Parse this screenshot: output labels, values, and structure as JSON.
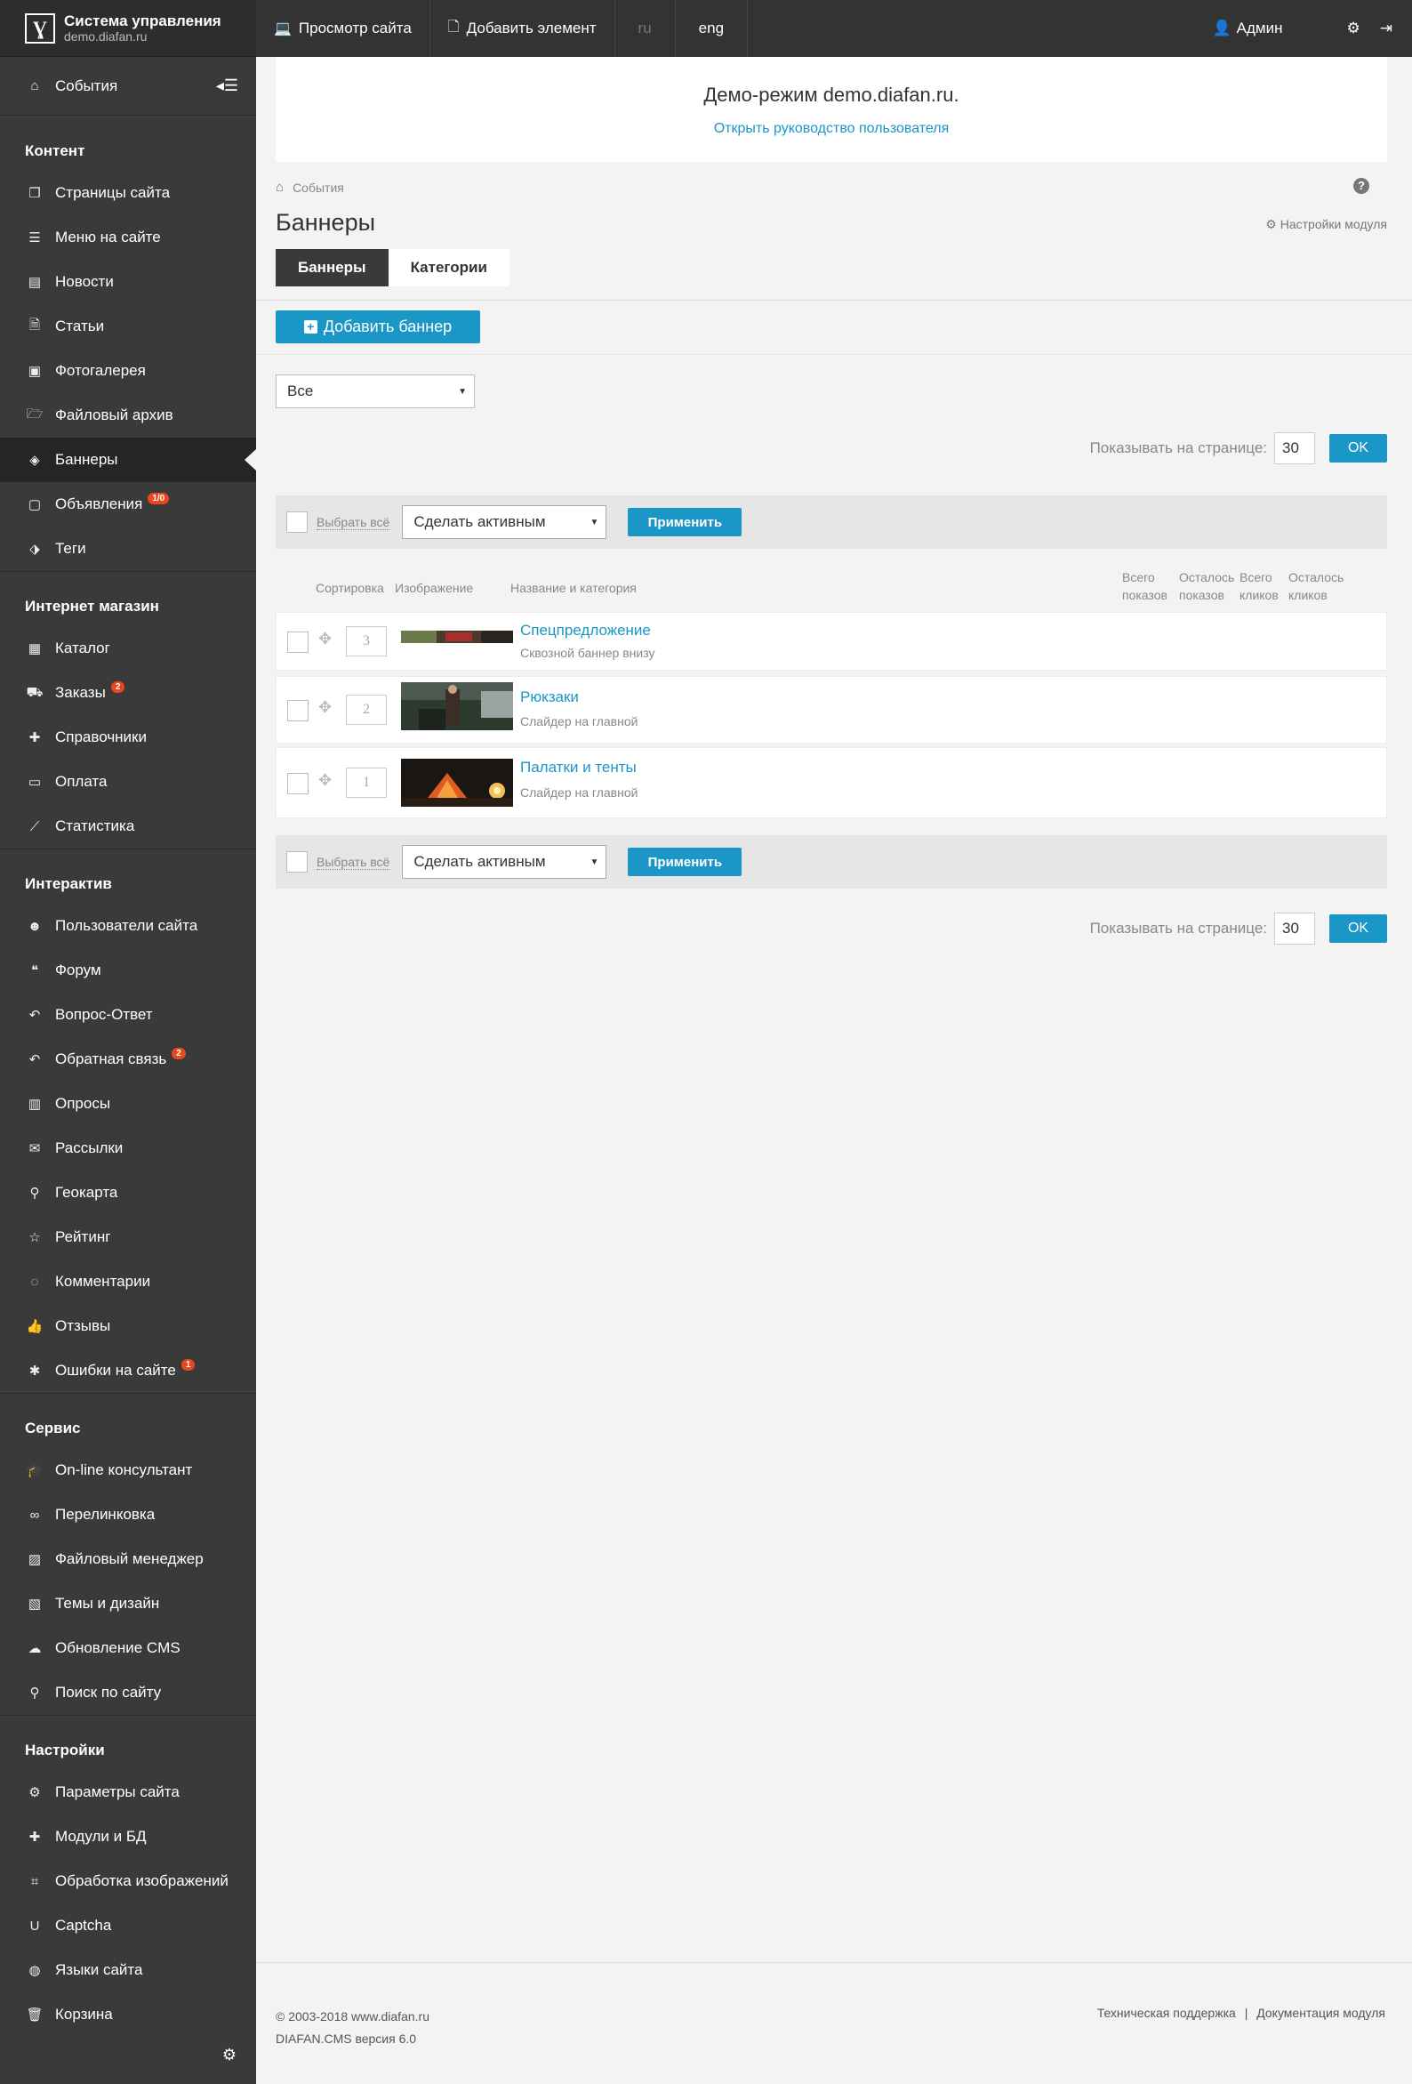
{
  "brand": {
    "title": "Система управления",
    "subtitle": "demo.diafan.ru"
  },
  "sidebar": {
    "events": "События",
    "sections": [
      {
        "title": "Контент",
        "items": [
          {
            "label": "Страницы сайта",
            "icon": "pages-icon",
            "glyph": "❐"
          },
          {
            "label": "Меню на сайте",
            "icon": "menu-icon",
            "glyph": "☰"
          },
          {
            "label": "Новости",
            "icon": "news-icon",
            "glyph": "▤"
          },
          {
            "label": "Статьи",
            "icon": "document-icon",
            "glyph": "🗎"
          },
          {
            "label": "Фотогалерея",
            "icon": "picture-icon",
            "glyph": "▣"
          },
          {
            "label": "Файловый архив",
            "icon": "folder-icon",
            "glyph": "🗁"
          },
          {
            "label": "Баннеры",
            "icon": "ticket-icon",
            "glyph": "◈",
            "active": true
          },
          {
            "label": "Объявления",
            "icon": "note-icon",
            "glyph": "▢",
            "badge": "1/0"
          },
          {
            "label": "Теги",
            "icon": "tags-icon",
            "glyph": "⬗"
          }
        ]
      },
      {
        "title": "Интернет магазин",
        "items": [
          {
            "label": "Каталог",
            "icon": "grid-icon",
            "glyph": "▦"
          },
          {
            "label": "Заказы",
            "icon": "cart-icon",
            "glyph": "⛟",
            "badge": "2"
          },
          {
            "label": "Справочники",
            "icon": "puzzle-icon",
            "glyph": "✚"
          },
          {
            "label": "Оплата",
            "icon": "credit-card-icon",
            "glyph": "▭"
          },
          {
            "label": "Статистика",
            "icon": "line-chart-icon",
            "glyph": "⟋"
          }
        ]
      },
      {
        "title": "Интерактив",
        "items": [
          {
            "label": "Пользователи сайта",
            "icon": "users-icon",
            "glyph": "☻"
          },
          {
            "label": "Форум",
            "icon": "comments-icon",
            "glyph": "❝"
          },
          {
            "label": "Вопрос-Ответ",
            "icon": "reply-icon",
            "glyph": "↶"
          },
          {
            "label": "Обратная связь",
            "icon": "feedback-icon",
            "glyph": "↶",
            "badge": "2"
          },
          {
            "label": "Опросы",
            "icon": "bar-chart-icon",
            "glyph": "▥"
          },
          {
            "label": "Рассылки",
            "icon": "envelope-icon",
            "glyph": "✉"
          },
          {
            "label": "Геокарта",
            "icon": "map-marker-icon",
            "glyph": "⚲"
          },
          {
            "label": "Рейтинг",
            "icon": "star-icon",
            "glyph": "☆"
          },
          {
            "label": "Комментарии",
            "icon": "comment-icon",
            "glyph": "◌"
          },
          {
            "label": "Отзывы",
            "icon": "thumbs-up-icon",
            "glyph": "👍"
          },
          {
            "label": "Ошибки на сайте",
            "icon": "bug-icon",
            "glyph": "✱",
            "badge": "1"
          }
        ]
      },
      {
        "title": "Сервис",
        "items": [
          {
            "label": "On-line консультант",
            "icon": "graduation-cap-icon",
            "glyph": "🎓"
          },
          {
            "label": "Перелинковка",
            "icon": "link-icon",
            "glyph": "∞"
          },
          {
            "label": "Файловый менеджер",
            "icon": "file-image-icon",
            "glyph": "▨"
          },
          {
            "label": "Темы и дизайн",
            "icon": "theme-icon",
            "glyph": "▧"
          },
          {
            "label": "Обновление CMS",
            "icon": "cloud-download-icon",
            "glyph": "☁"
          },
          {
            "label": "Поиск по сайту",
            "icon": "search-icon",
            "glyph": "⚲"
          }
        ]
      },
      {
        "title": "Настройки",
        "items": [
          {
            "label": "Параметры сайта",
            "icon": "cogs-icon",
            "glyph": "⚙"
          },
          {
            "label": "Модули и БД",
            "icon": "modules-icon",
            "glyph": "✚"
          },
          {
            "label": "Обработка изображений",
            "icon": "crop-icon",
            "glyph": "⌗"
          },
          {
            "label": "Captcha",
            "icon": "captcha-icon",
            "glyph": "U"
          },
          {
            "label": "Языки сайта",
            "icon": "globe-icon",
            "glyph": "◍"
          },
          {
            "label": "Корзина",
            "icon": "trash-icon",
            "glyph": "🗑"
          }
        ]
      }
    ]
  },
  "topbar": {
    "view_site": "Просмотр сайта",
    "add_element": "Добавить элемент",
    "lang_ru": "ru",
    "lang_eng": "eng",
    "admin": "Админ"
  },
  "demo": {
    "title": "Демо-режим demo.diafan.ru.",
    "link": "Открыть руководство пользователя"
  },
  "breadcrumb": "События",
  "page_title": "Баннеры",
  "module_settings": "Настройки модуля",
  "tabs": [
    "Баннеры",
    "Категории"
  ],
  "add_button": "Добавить баннер",
  "filter_value": "Все",
  "perpage": {
    "label": "Показывать на странице:",
    "value": "30",
    "ok": "OK"
  },
  "actions": {
    "select_all": "Выбрать всё",
    "action": "Сделать активным",
    "apply": "Применить"
  },
  "columns": {
    "sort": "Сортировка",
    "image": "Изображение",
    "name": "Название и категория",
    "total_views": [
      "Всего",
      "показов"
    ],
    "left_views": [
      "Осталось",
      "показов"
    ],
    "total_clicks": [
      "Всего",
      "кликов"
    ],
    "left_clicks": [
      "Осталось",
      "кликов"
    ]
  },
  "rows": [
    {
      "sort": "3",
      "title": "Спецпредложение",
      "category": "Сквозной баннер внизу"
    },
    {
      "sort": "2",
      "title": "Рюкзаки",
      "category": "Слайдер на главной"
    },
    {
      "sort": "1",
      "title": "Палатки и тенты",
      "category": "Слайдер на главной"
    }
  ],
  "footer": {
    "copyright": "© 2003-2018 www.diafan.ru",
    "version": "DIAFAN.CMS версия 6.0",
    "support": "Техническая поддержка",
    "sep": "|",
    "docs": "Документация модуля"
  },
  "colors": {
    "accent": "#1a96c7",
    "sidebar": "#3a3a3a",
    "badge": "#e8481c"
  }
}
